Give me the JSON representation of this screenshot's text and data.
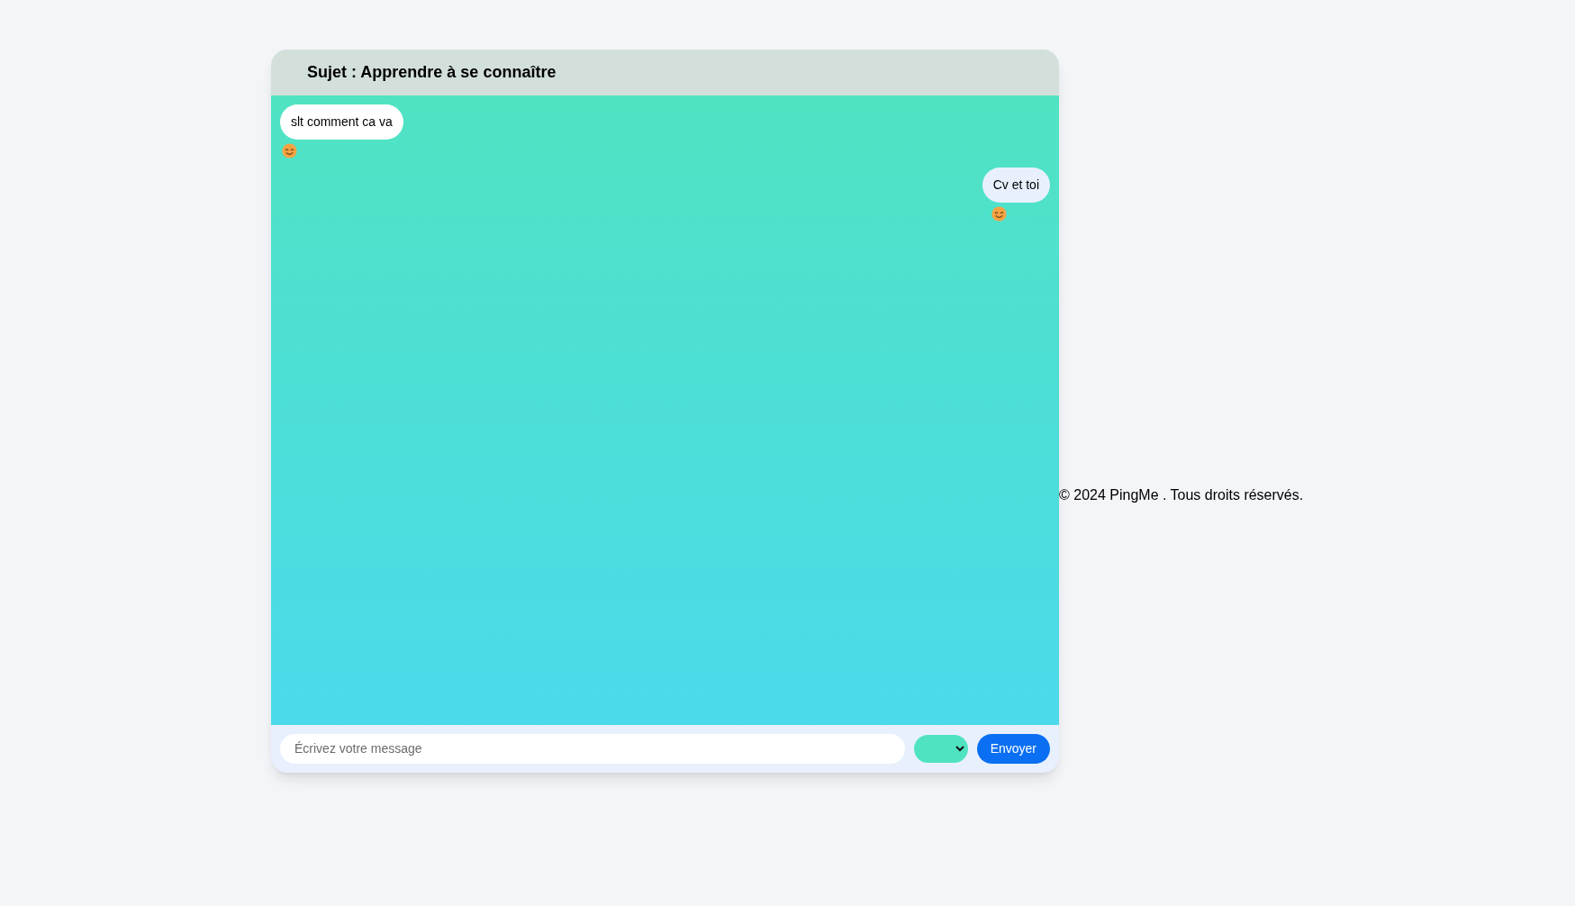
{
  "chat": {
    "subject": "Sujet : Apprendre à se connaître",
    "messages": [
      {
        "kind": "received",
        "text": "slt comment ca va"
      },
      {
        "kind": "sent",
        "text": "Cv et toi"
      }
    ],
    "composer": {
      "placeholder": "Écrivez votre message",
      "send_label": "Envoyer"
    }
  },
  "footer": {
    "text": "© 2024 PingMe . Tous droits réservés."
  }
}
